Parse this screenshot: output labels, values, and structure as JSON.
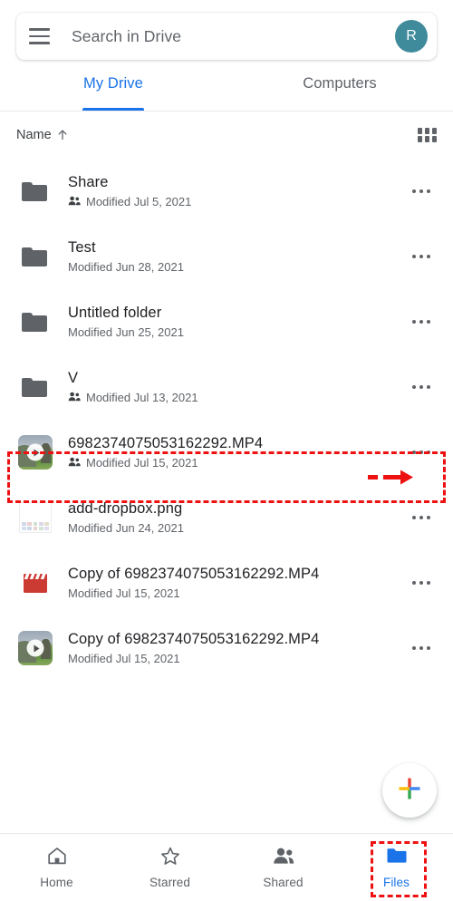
{
  "search": {
    "placeholder": "Search in Drive",
    "menu_icon": "hamburger-icon",
    "avatar_initial": "R",
    "avatar_color": "#3f8b9c"
  },
  "tabs": [
    {
      "label": "My Drive",
      "active": true
    },
    {
      "label": "Computers",
      "active": false
    }
  ],
  "sort": {
    "label": "Name",
    "direction_icon": "arrow-up-icon",
    "view_toggle_icon": "grid-view-icon"
  },
  "files": [
    {
      "name": "Share",
      "modified": "Modified Jul 5, 2021",
      "icon": "folder-icon",
      "shared": true,
      "menu_icon": "more-options-icon"
    },
    {
      "name": "Test",
      "modified": "Modified Jun 28, 2021",
      "icon": "folder-icon",
      "shared": false,
      "menu_icon": "more-options-icon"
    },
    {
      "name": "Untitled folder",
      "modified": "Modified Jun 25, 2021",
      "icon": "folder-icon",
      "shared": false,
      "menu_icon": "more-options-icon"
    },
    {
      "name": "V",
      "modified": "Modified Jul 13, 2021",
      "icon": "folder-icon",
      "shared": true,
      "menu_icon": "more-options-icon"
    },
    {
      "name": "6982374075053162292.MP4",
      "modified": "Modified Jul 15, 2021",
      "icon": "video-thumbnail",
      "shared": true,
      "highlighted": true,
      "menu_icon": "more-options-icon"
    },
    {
      "name": "add-dropbox.png",
      "modified": "Modified Jun 24, 2021",
      "icon": "image-thumbnail",
      "shared": false,
      "menu_icon": "more-options-icon"
    },
    {
      "name": "Copy of 6982374075053162292.MP4",
      "modified": "Modified Jul 15, 2021",
      "icon": "clapperboard-icon",
      "shared": false,
      "menu_icon": "more-options-icon"
    },
    {
      "name": "Copy of 6982374075053162292.MP4",
      "modified": "Modified Jul 15, 2021",
      "icon": "video-thumbnail",
      "shared": false,
      "menu_icon": "more-options-icon"
    }
  ],
  "fab": {
    "icon": "google-plus-icon",
    "colors": {
      "top": "#ea4335",
      "left": "#fbbc04",
      "right": "#4285f4",
      "bottom": "#34a853"
    }
  },
  "bottom_nav": [
    {
      "label": "Home",
      "icon": "home-icon",
      "active": false
    },
    {
      "label": "Starred",
      "icon": "star-icon",
      "active": false
    },
    {
      "label": "Shared",
      "icon": "people-icon",
      "active": false
    },
    {
      "label": "Files",
      "icon": "folder-icon",
      "active": true
    }
  ],
  "annotations": {
    "highlight_color": "#ee1111",
    "pointer_icon": "right-arrow-annotation",
    "targets": [
      "video-file-row",
      "files-nav-item"
    ]
  }
}
